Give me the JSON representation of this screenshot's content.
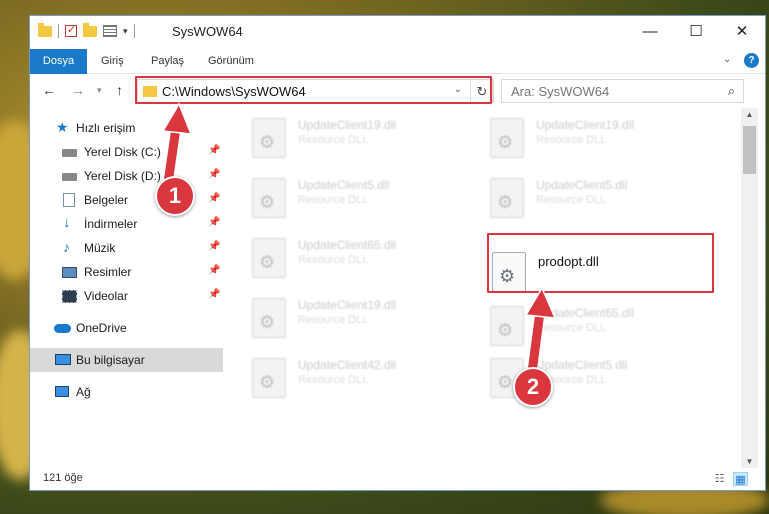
{
  "window": {
    "title": "SysWOW64",
    "minimize_glyph": "—",
    "maximize_glyph": "☐",
    "close_glyph": "✕"
  },
  "ribbon": {
    "tabs": [
      "Dosya",
      "Giriş",
      "Paylaş",
      "Görünüm"
    ],
    "help_glyph": "?"
  },
  "address": {
    "path": "C:\\Windows\\SysWOW64",
    "search_placeholder": "Ara: SysWOW64"
  },
  "sidebar": {
    "items": [
      {
        "label": "Hızlı erişim",
        "icon": "star-icon",
        "pinned": false
      },
      {
        "label": "Yerel Disk (C:)",
        "icon": "drive-icon",
        "pinned": true
      },
      {
        "label": "Yerel Disk (D:)",
        "icon": "drive-icon",
        "pinned": true
      },
      {
        "label": "Belgeler",
        "icon": "documents-icon",
        "pinned": true
      },
      {
        "label": "İndirmeler",
        "icon": "download-icon",
        "pinned": true
      },
      {
        "label": "Müzik",
        "icon": "music-icon",
        "pinned": true
      },
      {
        "label": "Resimler",
        "icon": "pictures-icon",
        "pinned": true
      },
      {
        "label": "Videolar",
        "icon": "video-icon",
        "pinned": true
      },
      {
        "label": "OneDrive",
        "icon": "cloud-icon",
        "pinned": false
      },
      {
        "label": "Bu bilgisayar",
        "icon": "computer-icon",
        "pinned": false
      },
      {
        "label": "Ağ",
        "icon": "network-icon",
        "pinned": false
      }
    ]
  },
  "files": [
    {
      "name": "UpdateClient19.dll",
      "type": "Resource DLL"
    },
    {
      "name": "UpdateClient19.dll",
      "type": "Resource DLL"
    },
    {
      "name": "UpdateClient5.dll",
      "type": "Resource DLL"
    },
    {
      "name": "UpdateClient5.dll",
      "type": "Resource DLL"
    },
    {
      "name": "UpdateClient65.dll",
      "type": "Resource DLL"
    },
    {
      "name": "prodopt.dll",
      "type": ""
    },
    {
      "name": "UpdateClient19.dll",
      "type": "Resource DLL"
    },
    {
      "name": "UpdateClient65.dll",
      "type": "Resource DLL"
    },
    {
      "name": "UpdateClient42.dll",
      "type": "Resource DLL"
    },
    {
      "name": "UpdateClient5.dll",
      "type": "Resource DLL"
    }
  ],
  "status": {
    "item_count": "121 öğe"
  },
  "annotations": {
    "callout_1": "1",
    "callout_2": "2",
    "color": "#d9363e"
  },
  "colors": {
    "accent": "#1979ca",
    "selection": "#cce8ff",
    "folder": "#f5c842"
  }
}
